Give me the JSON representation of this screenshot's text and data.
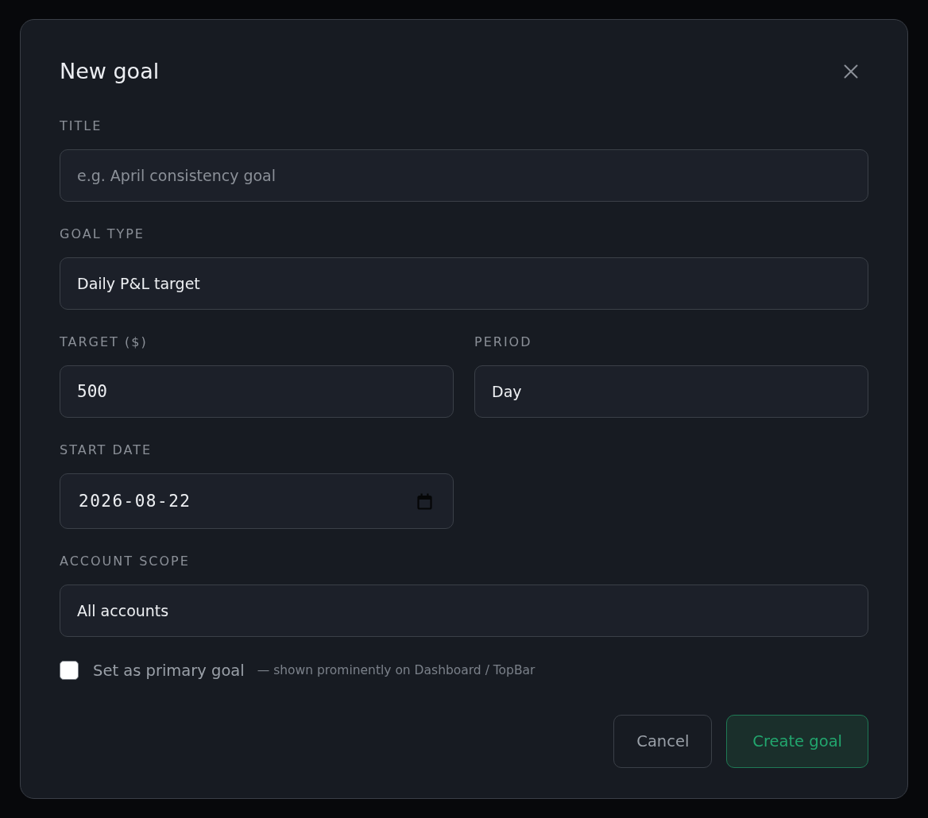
{
  "dialog": {
    "title": "New goal"
  },
  "rows": [
    [
      {
        "kind": "text",
        "label": "TITLE",
        "placeholder": "e.g. April consistency goal"
      }
    ],
    [
      {
        "kind": "select",
        "label": "GOAL TYPE",
        "value": "Daily P&L target"
      }
    ],
    [
      {
        "kind": "number",
        "label": "TARGET ($)",
        "value": "500"
      },
      {
        "kind": "select",
        "label": "PERIOD",
        "value": "Day"
      }
    ],
    [
      {
        "kind": "date",
        "label": "START DATE",
        "value": "2026-08-22"
      }
    ],
    [
      {
        "kind": "select",
        "label": "ACCOUNT SCOPE",
        "value": "All accounts"
      }
    ]
  ],
  "primary_option": {
    "label": "Set as primary goal",
    "hint": "— shown prominently on Dashboard / TopBar",
    "checked": false
  },
  "buttons": [
    {
      "label": "Cancel",
      "kind": "secondary"
    },
    {
      "label": "Create goal",
      "kind": "primary"
    }
  ]
}
